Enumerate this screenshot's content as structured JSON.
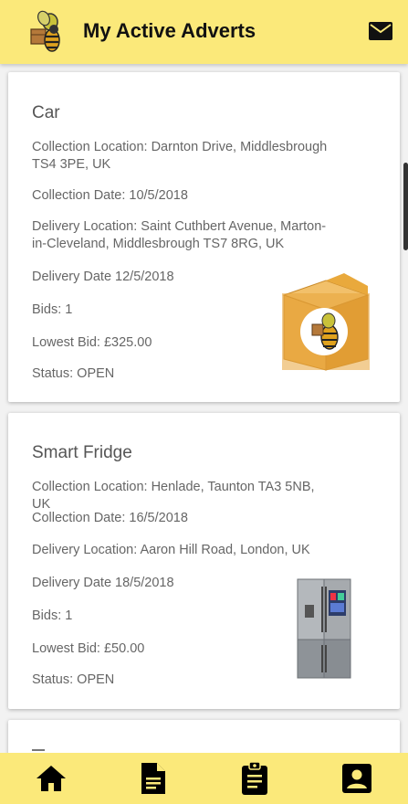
{
  "header": {
    "title": "My Active Adverts",
    "logo_icon": "bee-logo-icon",
    "mail_icon": "mail-icon"
  },
  "adverts": [
    {
      "title": "Car",
      "collection_location": "Collection Location: Darnton Drive, Middlesbrough TS4 3PE, UK",
      "collection_date": "Collection Date: 10/5/2018",
      "delivery_location": "Delivery Location: Saint Cuthbert Avenue, Marton-in-Cleveland, Middlesbrough TS7 8RG, UK",
      "delivery_date": "Delivery Date 12/5/2018",
      "bids": "Bids: 1",
      "lowest_bid": "Lowest Bid: £325.00",
      "status": "Status: OPEN",
      "image_icon": "parcel-box-icon"
    },
    {
      "title": "Smart Fridge",
      "collection_location": "Collection Location: Henlade, Taunton TA3 5NB, UK",
      "collection_date": "Collection Date: 16/5/2018",
      "delivery_location": "Delivery Location: Aaron Hill Road, London, UK",
      "delivery_date": "Delivery Date 18/5/2018",
      "bids": "Bids: 1",
      "lowest_bid": "Lowest Bid: £50.00",
      "status": "Status: OPEN",
      "image_icon": "fridge-icon"
    }
  ],
  "bottom_nav": [
    "home-icon",
    "document-icon",
    "clipboard-icon",
    "account-box-icon"
  ],
  "colors": {
    "accent": "#fbe97a",
    "card_text": "#666666"
  }
}
